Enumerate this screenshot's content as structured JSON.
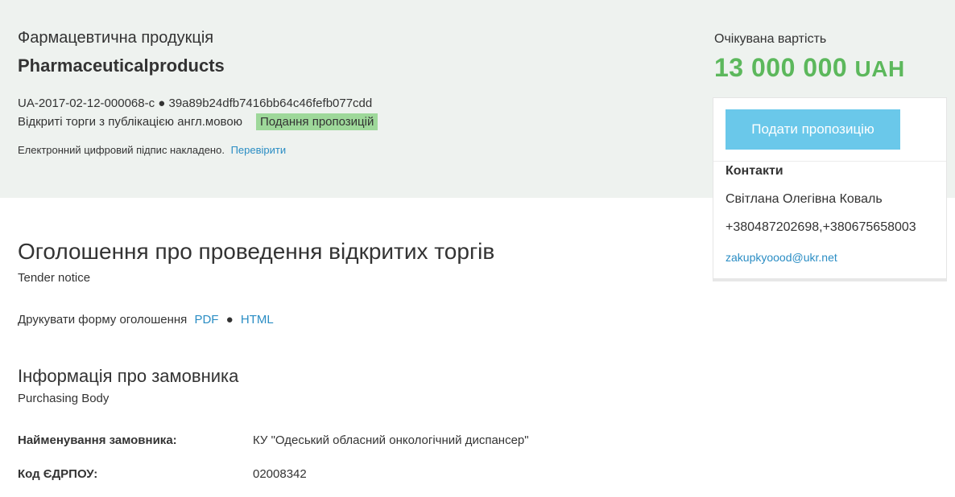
{
  "tender": {
    "title_ua": "Фармацевтична продукція",
    "title_en": "Pharmaceuticalproducts",
    "ids": "UA-2017-02-12-000068-c ● 39a89b24dfb7416bb64c46fefb077cdd",
    "procedure": "Відкриті торги з публікацією англ.мовою",
    "status": "Подання пропозицій",
    "signature_text": "Електронний цифровий підпис накладено.",
    "signature_link": "Перевірити"
  },
  "value": {
    "label": "Очікувана вартість",
    "amount": "13 000 000",
    "currency": "UAH"
  },
  "side_card": {
    "bid_button": "Подати пропозицію",
    "contacts_title": "Контакти",
    "contact_name": "Світлана Олегівна Коваль",
    "contact_phone": "+380487202698,+380675658003",
    "contact_email": "zakupkyoood@ukr.net"
  },
  "notice": {
    "title": "Оголошення про проведення відкритих торгів",
    "subtitle": "Tender notice",
    "print_label": "Друкувати форму оголошення",
    "pdf_link": "PDF",
    "separator": "●",
    "html_link": "HTML"
  },
  "purchasing_body": {
    "title": "Інформація про замовника",
    "subtitle": "Purchasing Body",
    "rows": [
      {
        "label": "Найменування замовника:",
        "value": "КУ \"Одеський обласний онкологічний диспансер\""
      },
      {
        "label": "Код ЄДРПОУ:",
        "value": "02008342"
      }
    ]
  },
  "colors": {
    "header_bg": "#eef2ef",
    "accent_green": "#5cb85c",
    "status_badge": "#9ed89a",
    "button_blue": "#6ac8ea",
    "link_blue": "#2a8dc4"
  }
}
